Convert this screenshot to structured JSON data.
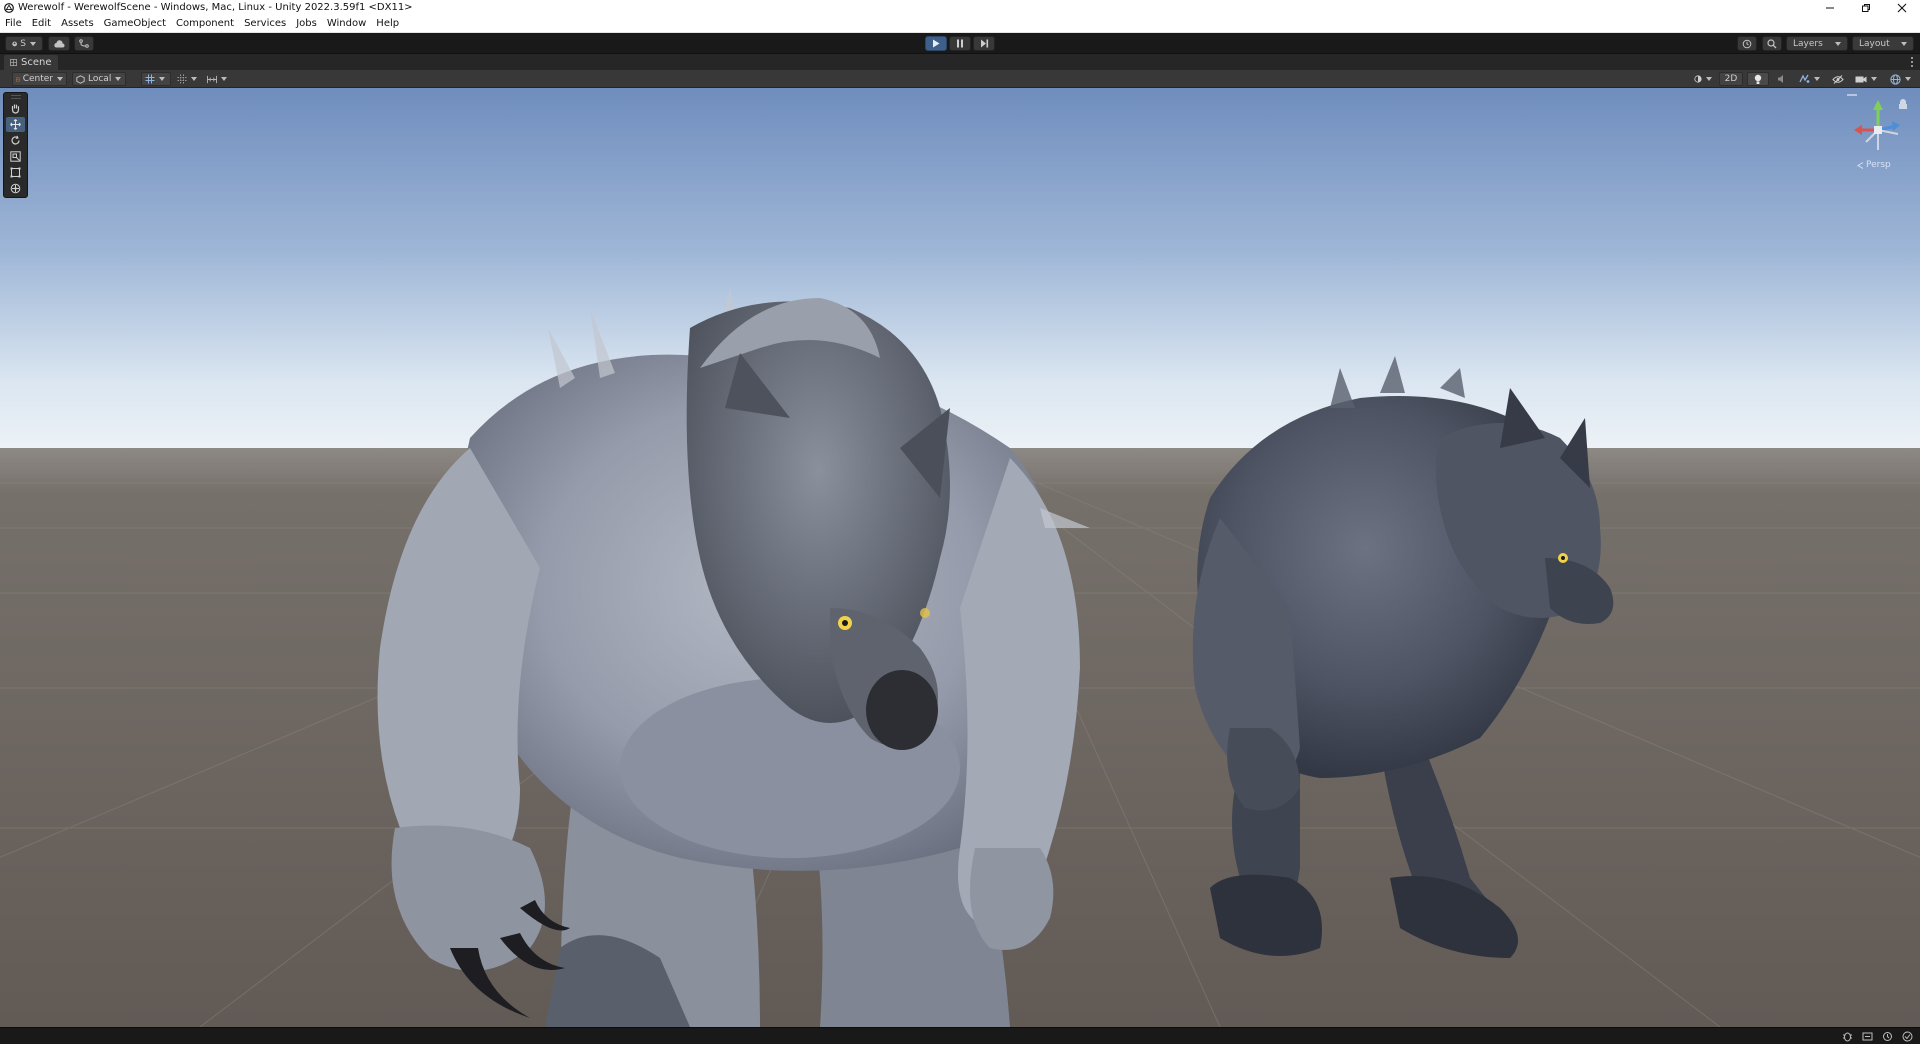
{
  "window": {
    "title": "Werewolf - WerewolfScene - Windows, Mac, Linux - Unity 2022.3.59f1 <DX11>"
  },
  "menu": [
    "File",
    "Edit",
    "Assets",
    "GameObject",
    "Component",
    "Services",
    "Jobs",
    "Window",
    "Help"
  ],
  "toolbar": {
    "account_label": "S",
    "layers_label": "Layers",
    "layout_label": "Layout"
  },
  "scene_tab": {
    "label": "Scene"
  },
  "scene_toolbar": {
    "pivot_label": "Center",
    "space_label": "Local",
    "mode_2d_label": "2D"
  },
  "gizmo": {
    "projection_label": "Persp"
  },
  "colors": {
    "play_active": "#3e5f8a",
    "sky_top": "#6f8fbf",
    "horizon": "#e6eef6",
    "ground": "#6a625e",
    "fur_light": "#9aa0ad",
    "fur_dark": "#474c58",
    "eye": "#f2d24a"
  }
}
